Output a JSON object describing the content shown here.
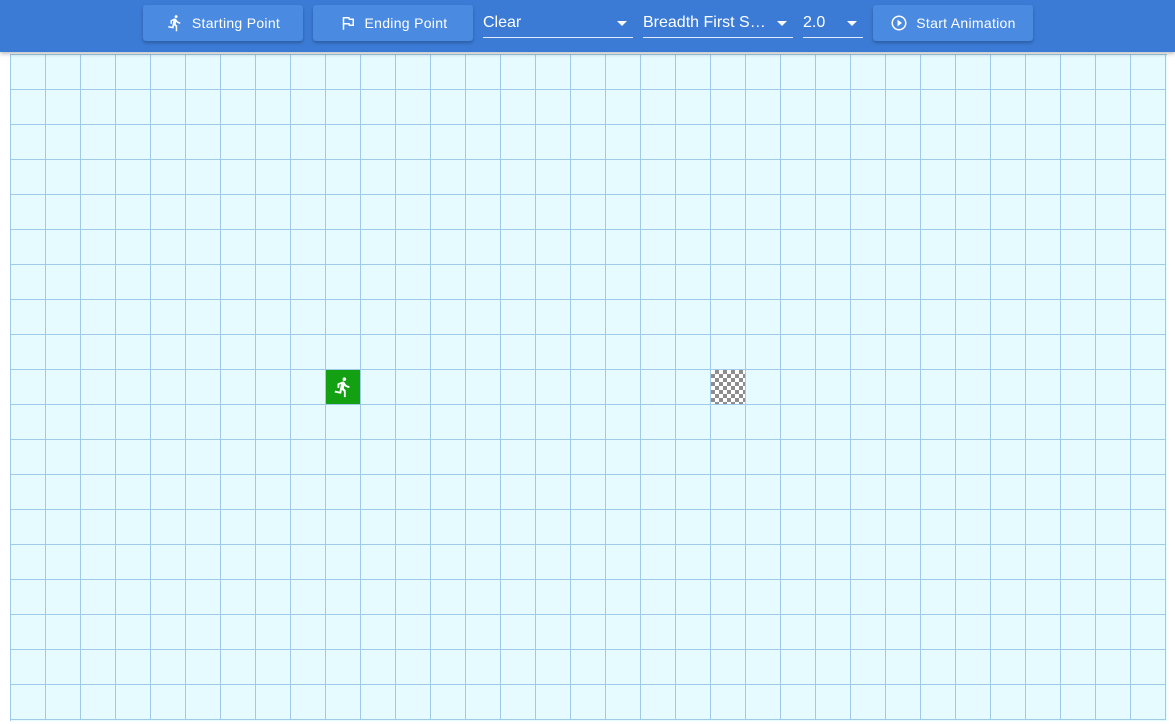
{
  "toolbar": {
    "starting_point_label": "Starting Point",
    "ending_point_label": "Ending Point",
    "wall_mode": {
      "selected": "Clear"
    },
    "algorithm": {
      "selected": "Breadth First S…"
    },
    "speed": {
      "selected": "2.0"
    },
    "start_animation_label": "Start Animation"
  },
  "icons": {
    "starting_point": "running-person-icon",
    "ending_point": "flag-icon",
    "start_animation": "play-circle-icon",
    "start_cell": "running-person-icon",
    "end_cell": "checkered-flag-icon",
    "dropdown": "caret-down-icon"
  },
  "grid": {
    "columns": 33,
    "rows": 19,
    "start_cell": {
      "row": 9,
      "col": 9
    },
    "end_cell": {
      "row": 9,
      "col": 20
    }
  },
  "colors": {
    "toolbar_bg": "#3b7bd6",
    "button_bg": "#4a8ae0",
    "cell_bg": "#e6fbff",
    "cell_border": "#9fcbe8",
    "start_cell": "#13a113",
    "end_checker": "#8d8d8d"
  }
}
